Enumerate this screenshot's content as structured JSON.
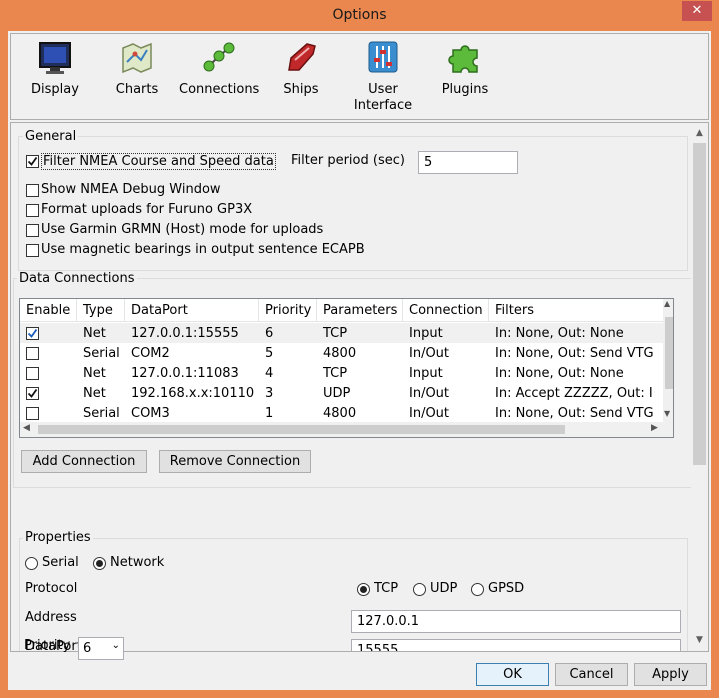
{
  "window": {
    "title": "Options",
    "close_label": "✕"
  },
  "toolbar": {
    "items": [
      {
        "label": "Display"
      },
      {
        "label": "Charts"
      },
      {
        "label": "Connections"
      },
      {
        "label": "Ships"
      },
      {
        "label": "User Interface"
      },
      {
        "label": "Plugins"
      }
    ]
  },
  "general": {
    "legend": "General",
    "filter_label": "Filter NMEA Course and Speed data",
    "filter_checked": true,
    "filter_period_label": "Filter period (sec)",
    "filter_period_value": "5",
    "options": [
      {
        "label": "Show NMEA Debug Window",
        "checked": false
      },
      {
        "label": "Format uploads for Furuno GP3X",
        "checked": false
      },
      {
        "label": "Use Garmin GRMN (Host) mode for uploads",
        "checked": false
      },
      {
        "label": "Use magnetic bearings in output sentence ECAPB",
        "checked": false
      }
    ]
  },
  "data_connections": {
    "legend": "Data Connections",
    "columns": [
      "Enable",
      "Type",
      "DataPort",
      "Priority",
      "Parameters",
      "Connection",
      "Filters"
    ],
    "rows": [
      {
        "enabled": true,
        "type": "Net",
        "port": "127.0.0.1:15555",
        "priority": "6",
        "params": "TCP",
        "connection": "Input",
        "filters": "In: None, Out: None"
      },
      {
        "enabled": false,
        "type": "Serial",
        "port": "COM2",
        "priority": "5",
        "params": "4800",
        "connection": "In/Out",
        "filters": "In: None, Out: Send VTG"
      },
      {
        "enabled": false,
        "type": "Net",
        "port": "127.0.0.1:11083",
        "priority": "4",
        "params": "TCP",
        "connection": "Input",
        "filters": "In: None, Out: None"
      },
      {
        "enabled": true,
        "type": "Net",
        "port": "192.168.x.x:10110",
        "priority": "3",
        "params": "UDP",
        "connection": "In/Out",
        "filters": "In: Accept ZZZZZ, Out: I"
      },
      {
        "enabled": false,
        "type": "Serial",
        "port": "COM3",
        "priority": "1",
        "params": "4800",
        "connection": "In/Out",
        "filters": "In: None, Out: Send VTG"
      }
    ],
    "add_label": "Add Connection",
    "remove_label": "Remove Connection"
  },
  "properties": {
    "legend": "Properties",
    "serial_label": "Serial",
    "network_label": "Network",
    "selected_mode": "Network",
    "protocol_label": "Protocol",
    "protocols": [
      "TCP",
      "UDP",
      "GPSD"
    ],
    "selected_protocol": "TCP",
    "address_label": "Address",
    "address_value": "127.0.0.1",
    "dataport_label": "DataPort",
    "dataport_value": "15555",
    "priority_label": "Priority",
    "priority_value": "6"
  },
  "buttons": {
    "ok": "OK",
    "cancel": "Cancel",
    "apply": "Apply"
  }
}
